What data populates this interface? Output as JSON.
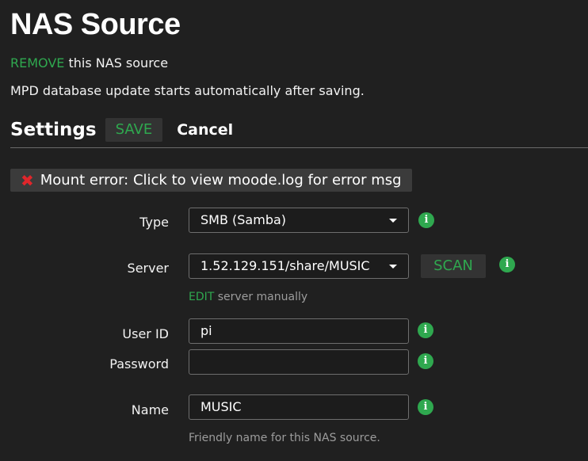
{
  "page": {
    "title": "NAS Source",
    "remove_link": "REMOVE",
    "remove_suffix": " this NAS source",
    "info": "MPD database update starts automatically after saving."
  },
  "settings": {
    "title": "Settings",
    "save_label": "SAVE",
    "cancel_label": "Cancel"
  },
  "error": {
    "icon": "✖",
    "message": "Mount error: Click to view moode.log for error msg"
  },
  "form": {
    "type": {
      "label": "Type",
      "value": "SMB (Samba)"
    },
    "server": {
      "label": "Server",
      "value": "1.52.129.151/share/MUSIC",
      "scan_label": "SCAN",
      "edit_link": "EDIT",
      "edit_suffix": " server manually"
    },
    "user_id": {
      "label": "User ID",
      "value": "pi"
    },
    "password": {
      "label": "Password",
      "value": ""
    },
    "name": {
      "label": "Name",
      "value": "MUSIC",
      "help": "Friendly name for this NAS source."
    }
  },
  "colors": {
    "background": "#202020",
    "accent_green": "#2fa84f",
    "error_red": "#e0262b"
  },
  "icons": {
    "info": "info-icon",
    "error": "error-x-icon",
    "dropdown": "chevron-down-icon"
  }
}
